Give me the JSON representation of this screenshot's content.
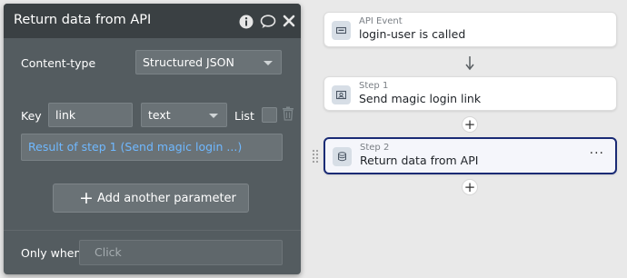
{
  "panel": {
    "title": "Return data from API",
    "icons": [
      "info-icon",
      "comment-icon",
      "close-icon"
    ],
    "content_type_label": "Content-type",
    "content_type_value": "Structured JSON",
    "key_label": "Key",
    "key_value": "link",
    "type_value": "text",
    "list_label": "List",
    "list_checked": false,
    "expression": "Result of step 1 (Send magic login ...)",
    "add_param_label": "Add another parameter",
    "only_when_label": "Only when",
    "only_when_placeholder": "Click"
  },
  "workflow": {
    "event": {
      "sub": "API Event",
      "title": "login-user is called",
      "icon": "api-event-icon"
    },
    "steps": [
      {
        "sub": "Step 1",
        "title": "Send magic login link",
        "icon": "email-icon",
        "selected": false
      },
      {
        "sub": "Step 2",
        "title": "Return data from API",
        "icon": "database-icon",
        "selected": true,
        "more": "···"
      }
    ],
    "add_symbol": "+"
  },
  "colors": {
    "panel_bg": "#545c60",
    "header_bg": "#3a4043",
    "expression_text": "#6fb8ff",
    "selected_border": "#1a2b75"
  }
}
